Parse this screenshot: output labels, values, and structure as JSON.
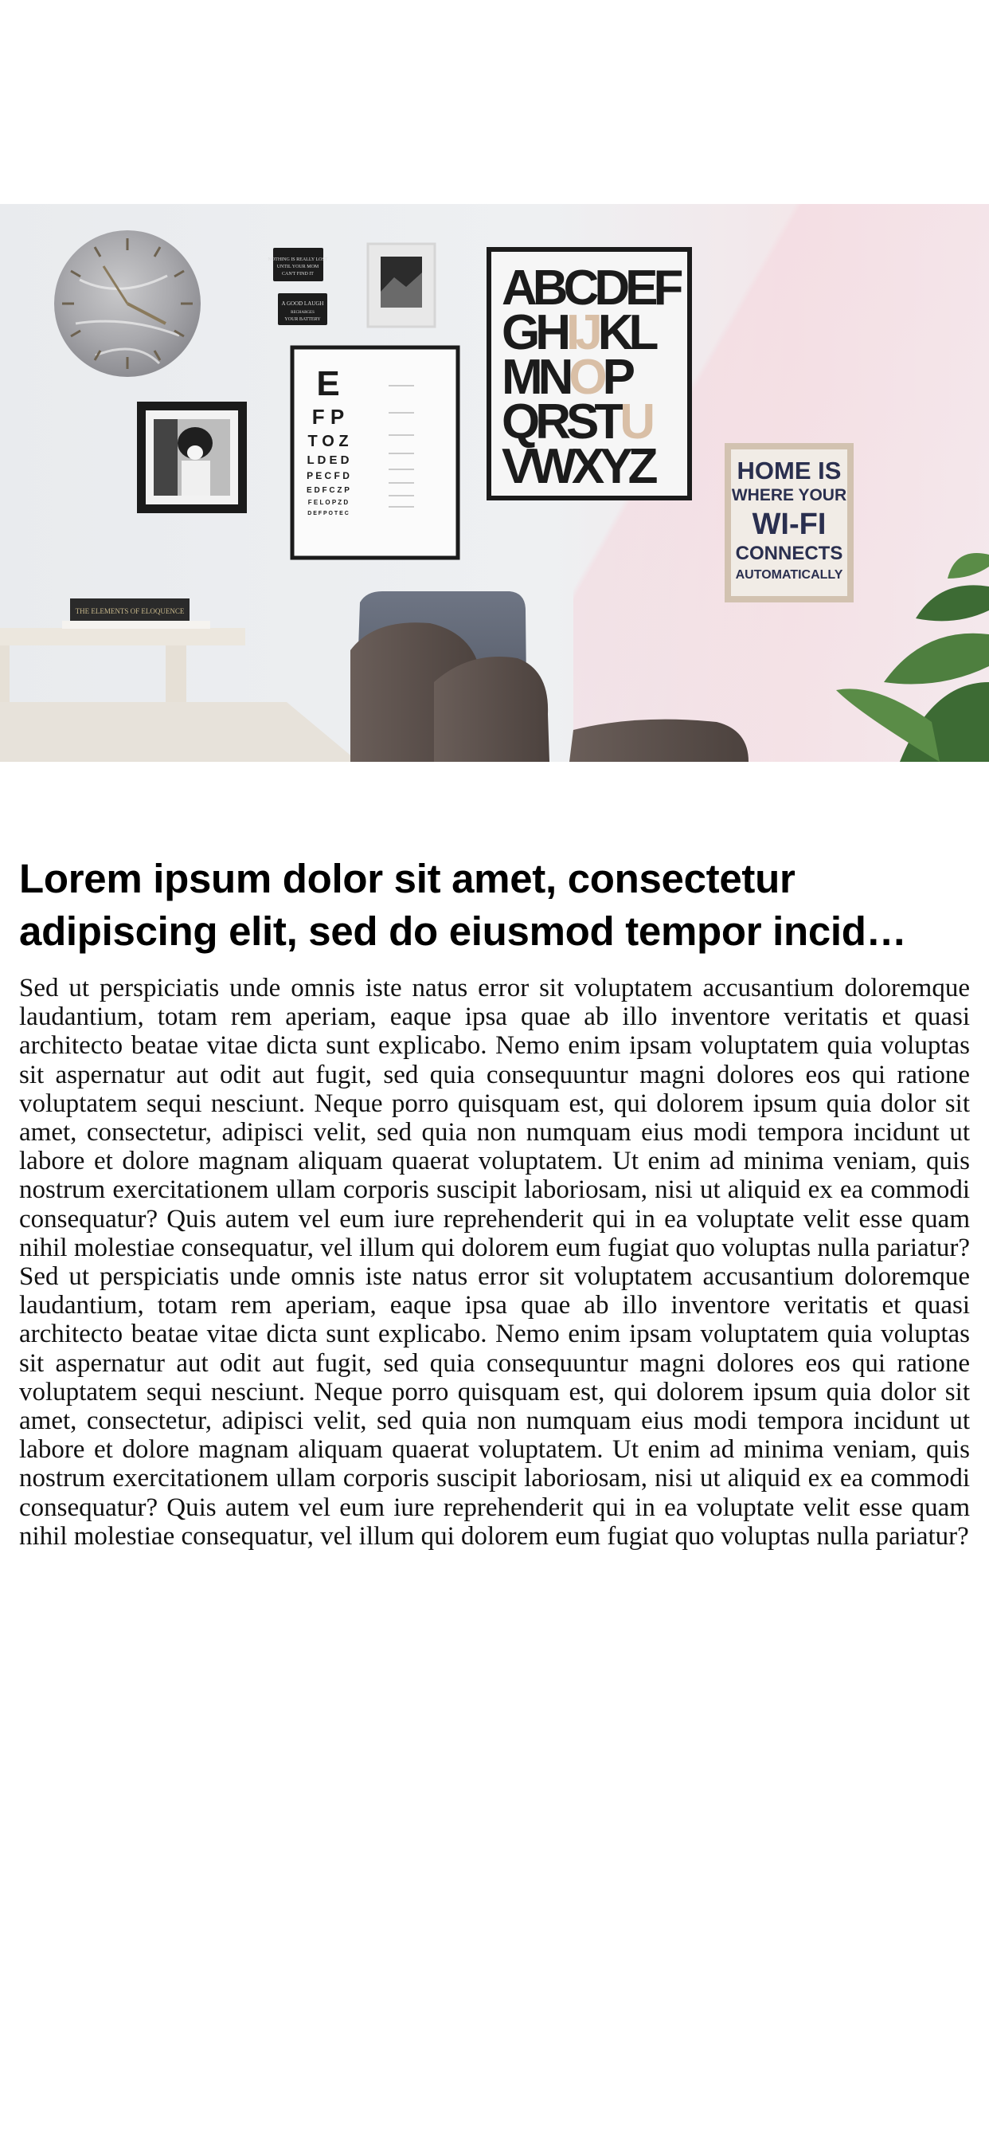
{
  "hero_image": {
    "alt": "Wall gallery with clock, eye chart, alphabet poster and Wi-Fi sign above a dining table",
    "signs": {
      "small_sign_1": "NOTHING IS REALLY LOST UNTIL YOUR MOM CAN'T FIND IT",
      "small_sign_2": "A GOOD LAUGH RECHARGES YOUR BATTERY",
      "eye_chart_rows": [
        "E",
        "F P",
        "T O Z",
        "L D E D",
        "P E C F D",
        "E D F C Z P",
        "F E L O P Z D"
      ],
      "alphabet_poster": [
        "ABCDEF",
        "GHIJKL",
        "MNOP",
        "QRSTU",
        "VWXYZ"
      ],
      "wifi_sign": [
        "HOME IS",
        "WHERE YOUR",
        "WI-FI",
        "CONNECTS",
        "AUTOMATICALLY"
      ],
      "book_title": "THE ELEMENTS OF ELOQUENCE"
    }
  },
  "article": {
    "headline": "Lorem ipsum dolor sit amet, consectetur adipiscing elit, sed do eiusmod tempor incid…",
    "body": "Sed ut perspiciatis unde omnis iste natus error sit voluptatem accusantium doloremque laudantium, totam rem aperiam, eaque ipsa quae ab illo inventore veritatis et quasi architecto beatae vitae dicta sunt explicabo. Nemo enim ipsam voluptatem quia voluptas sit aspernatur aut odit aut fugit, sed quia consequuntur magni dolores eos qui ratione voluptatem sequi nesciunt. Neque porro quisquam est, qui dolorem ipsum quia dolor sit amet, consectetur, adipisci velit, sed quia non numquam eius modi tempora incidunt ut labore et dolore magnam aliquam quaerat voluptatem. Ut enim ad minima veniam, quis nostrum exercitationem ullam corporis suscipit laboriosam, nisi ut aliquid ex ea commodi consequatur? Quis autem vel eum iure reprehenderit qui in ea voluptate velit esse quam nihil molestiae consequatur, vel illum qui dolorem eum fugiat quo voluptas nulla pariatur? Sed ut perspiciatis unde omnis iste natus error sit voluptatem accusantium doloremque laudantium, totam rem aperiam, eaque ipsa quae ab illo inventore veritatis et quasi architecto beatae vitae dicta sunt explicabo. Nemo enim ipsam voluptatem quia voluptas sit aspernatur aut odit aut fugit, sed quia consequuntur magni dolores eos qui ratione voluptatem sequi nesciunt. Neque porro quisquam est, qui dolorem ipsum quia dolor sit amet, consectetur, adipisci velit, sed quia non numquam eius modi tempora incidunt ut labore et dolore magnam aliquam quaerat voluptatem. Ut enim ad minima veniam, quis nostrum exercitationem ullam corporis suscipit laboriosam, nisi ut aliquid ex ea commodi consequatur? Quis autem vel eum iure reprehenderit qui in ea voluptate velit esse quam nihil molestiae consequatur, vel illum qui dolorem eum fugiat quo voluptas nulla pariatur?"
  },
  "colors": {
    "background": "#ffffff",
    "text": "#000000",
    "frame_black": "#1b1b1b",
    "sign_navy": "#2a2f4f"
  }
}
